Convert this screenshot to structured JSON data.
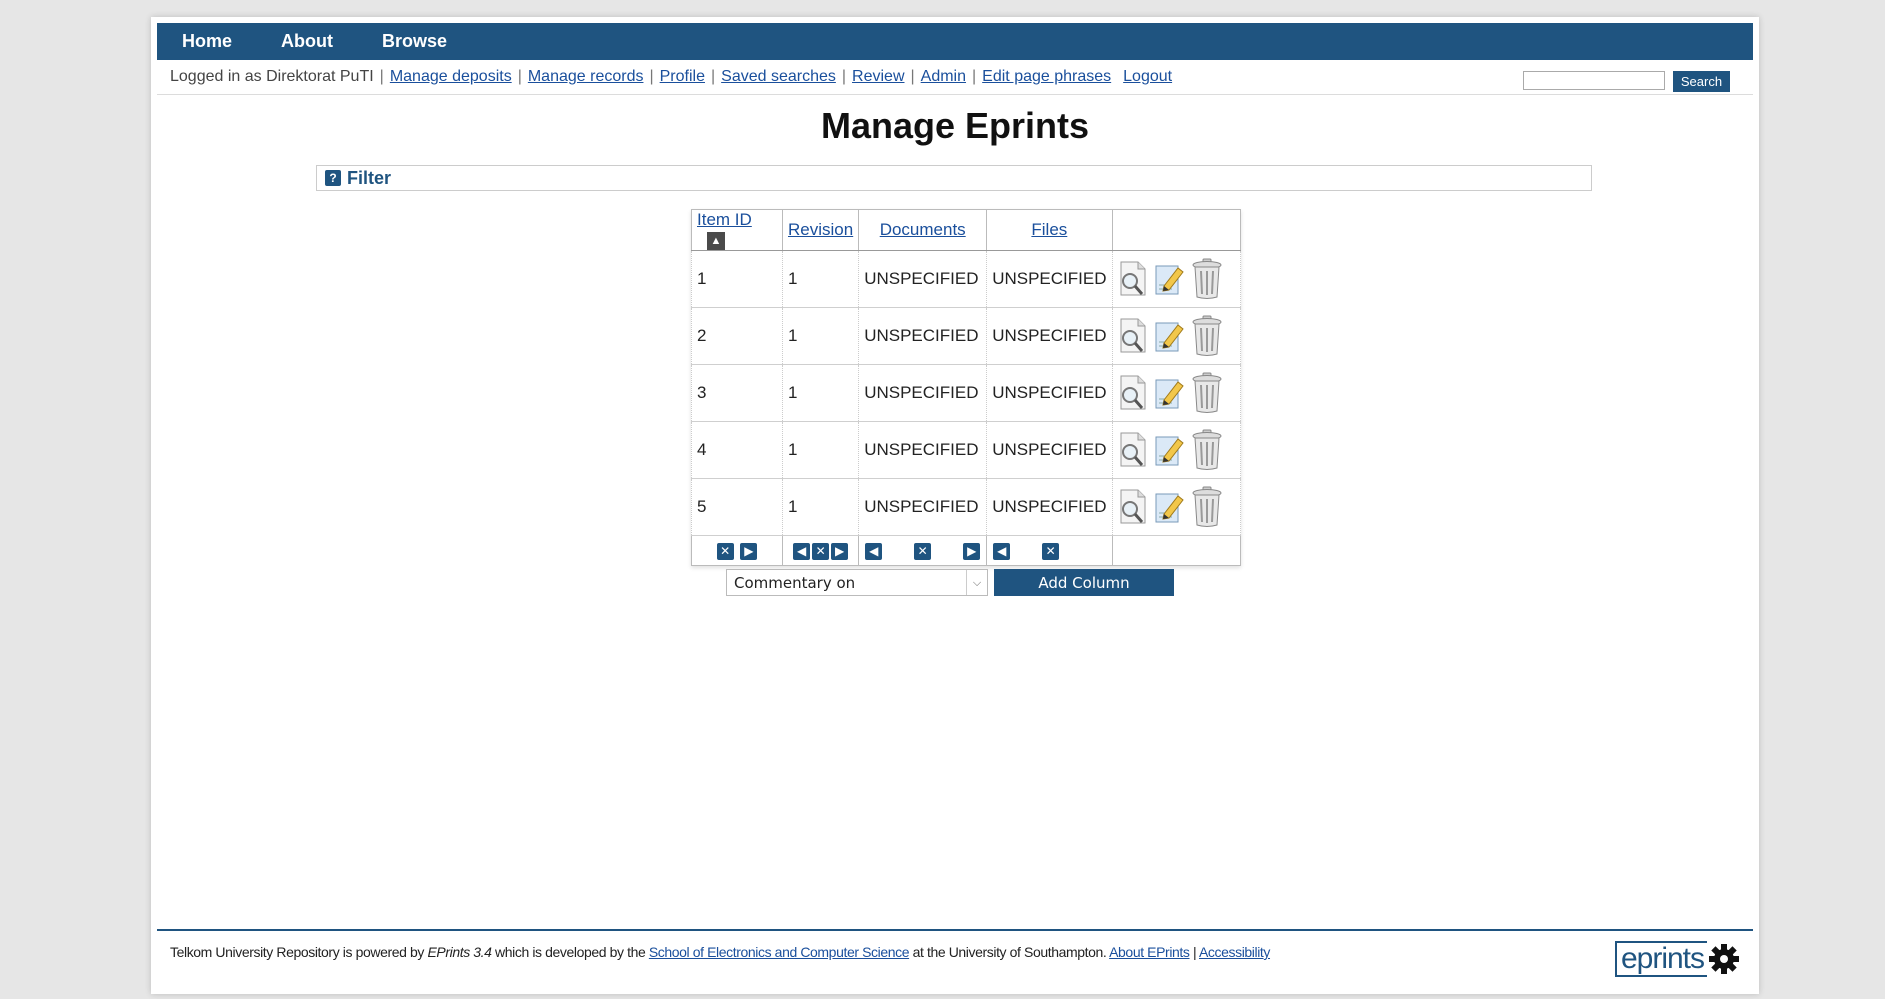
{
  "nav": {
    "items": [
      "Home",
      "About",
      "Browse"
    ]
  },
  "toolbar": {
    "logged_in_as": "Logged in as Direktorat PuTI",
    "links": [
      "Manage deposits",
      "Manage records",
      "Profile",
      "Saved searches",
      "Review",
      "Admin",
      "Edit page phrases"
    ],
    "logout": "Logout",
    "search_button": "Search",
    "search_value": ""
  },
  "page_title": "Manage Eprints",
  "filter": {
    "label": "Filter",
    "help_icon": "?"
  },
  "table": {
    "columns": [
      "Item ID",
      "Revision",
      "Documents",
      "Files"
    ],
    "sort_indicator": "▲",
    "rows": [
      {
        "id": "1",
        "revision": "1",
        "documents": "UNSPECIFIED",
        "files": "UNSPECIFIED"
      },
      {
        "id": "2",
        "revision": "1",
        "documents": "UNSPECIFIED",
        "files": "UNSPECIFIED"
      },
      {
        "id": "3",
        "revision": "1",
        "documents": "UNSPECIFIED",
        "files": "UNSPECIFIED"
      },
      {
        "id": "4",
        "revision": "1",
        "documents": "UNSPECIFIED",
        "files": "UNSPECIFIED"
      },
      {
        "id": "5",
        "revision": "1",
        "documents": "UNSPECIFIED",
        "files": "UNSPECIFIED"
      }
    ],
    "row_actions": [
      "view-icon",
      "edit-icon",
      "trash-icon"
    ],
    "column_controls": {
      "remove": "✕",
      "move_left": "◀",
      "move_right": "▶"
    }
  },
  "add_column": {
    "selected": "Commentary on",
    "button": "Add Column"
  },
  "footer": {
    "prefix": "Telkom University Repository is powered by ",
    "eprints_version": "EPrints 3.4",
    "middle": " which is developed by the ",
    "school_link": "School of Electronics and Computer Science",
    "suffix": " at the University of Southampton. ",
    "about_link": "About EPrints",
    "pipe": " | ",
    "accessibility_link": "Accessibility",
    "logo_text": "eprints"
  },
  "colors": {
    "brand": "#1f5480",
    "link": "#1a4f9c"
  }
}
